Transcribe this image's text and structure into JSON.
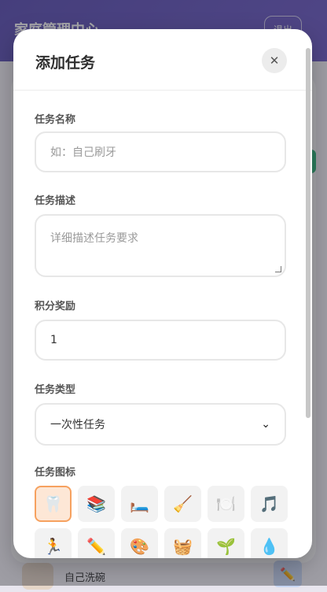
{
  "background": {
    "app_title": "家庭管理中心",
    "logout_label": "退出",
    "list_item_label": "自己洗碗"
  },
  "modal": {
    "title": "添加任务",
    "close_label": "✕"
  },
  "form": {
    "name_label": "任务名称",
    "name_placeholder": "如：自己刷牙",
    "description_label": "任务描述",
    "description_placeholder": "详细描述任务要求",
    "points_label": "积分奖励",
    "points_value": "1",
    "type_label": "任务类型",
    "type_selected": "一次性任务",
    "icon_label": "任务图标"
  },
  "icons": [
    {
      "name": "tooth-icon",
      "glyph": "🦷",
      "selected": true
    },
    {
      "name": "books-icon",
      "glyph": "📚",
      "selected": false
    },
    {
      "name": "bed-icon",
      "glyph": "🛏️",
      "selected": false
    },
    {
      "name": "broom-icon",
      "glyph": "🧹",
      "selected": false
    },
    {
      "name": "plate-icon",
      "glyph": "🍽️",
      "selected": false
    },
    {
      "name": "music-icon",
      "glyph": "🎵",
      "selected": false
    },
    {
      "name": "running-icon",
      "glyph": "🏃",
      "selected": false
    },
    {
      "name": "pencil-icon",
      "glyph": "✏️",
      "selected": false
    },
    {
      "name": "palette-icon",
      "glyph": "🎨",
      "selected": false
    },
    {
      "name": "basket-icon",
      "glyph": "🧺",
      "selected": false
    },
    {
      "name": "sprout-icon",
      "glyph": "🌱",
      "selected": false
    },
    {
      "name": "water-drop-icon",
      "glyph": "💧",
      "selected": false
    }
  ]
}
